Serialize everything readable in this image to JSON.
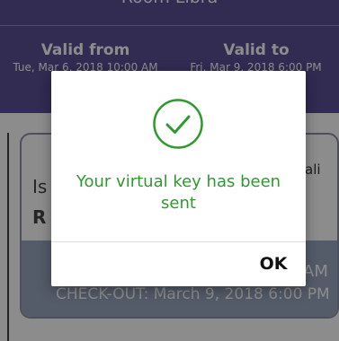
{
  "header": {
    "room_title": "Room Libra",
    "valid_from_label": "Valid from",
    "valid_to_label": "Valid to",
    "valid_from_value": "Tue, Mar 6, 2018 10:00 AM",
    "valid_to_value": "Fri, Mar 9, 2018 6:00 PM"
  },
  "card": {
    "name_tail": "ali",
    "line_1": "Is",
    "line_2": "R",
    "checkin_tail": "AM",
    "checkout": "CHECK-OUT: March 9, 2018 6:00 PM"
  },
  "dialog": {
    "icon": "check-circle-icon",
    "message": "Your virtual key has been sent",
    "ok_label": "OK"
  },
  "colors": {
    "header_purple": "#5b4f96",
    "success_green": "#2e9a2e",
    "card_footer": "#9aa6c0"
  }
}
